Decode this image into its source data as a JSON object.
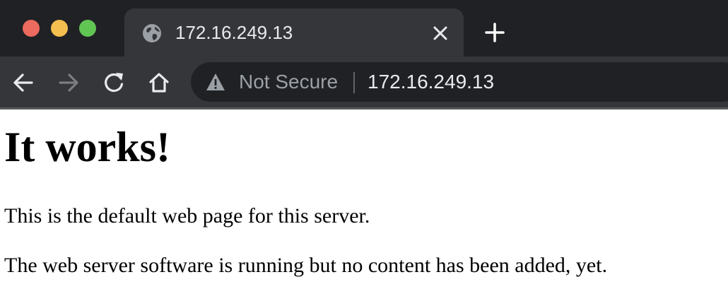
{
  "window": {
    "traffic_lights": {
      "close_color": "#ed6a5e",
      "minimize_color": "#f4bf4f",
      "maximize_color": "#61c554"
    }
  },
  "tab": {
    "title": "172.16.249.13",
    "favicon": "globe-icon",
    "close_icon": "close-icon"
  },
  "new_tab": {
    "icon": "plus-icon"
  },
  "toolbar": {
    "back_icon": "arrow-left-icon",
    "forward_icon": "arrow-right-icon",
    "reload_icon": "reload-icon",
    "home_icon": "home-icon"
  },
  "omnibox": {
    "security_icon": "warning-icon",
    "security_label": "Not Secure",
    "url": "172.16.249.13"
  },
  "page": {
    "heading": "It works!",
    "paragraphs": [
      "This is the default web page for this server.",
      "The web server software is running but no content has been added, yet."
    ]
  },
  "colors": {
    "titlebar": "#202124",
    "toolbar": "#35363a",
    "omnibox": "#202124",
    "tab_text": "#e8eaed",
    "security_text": "#9aa0a6",
    "page_background": "#ffffff",
    "page_text": "#000000"
  }
}
